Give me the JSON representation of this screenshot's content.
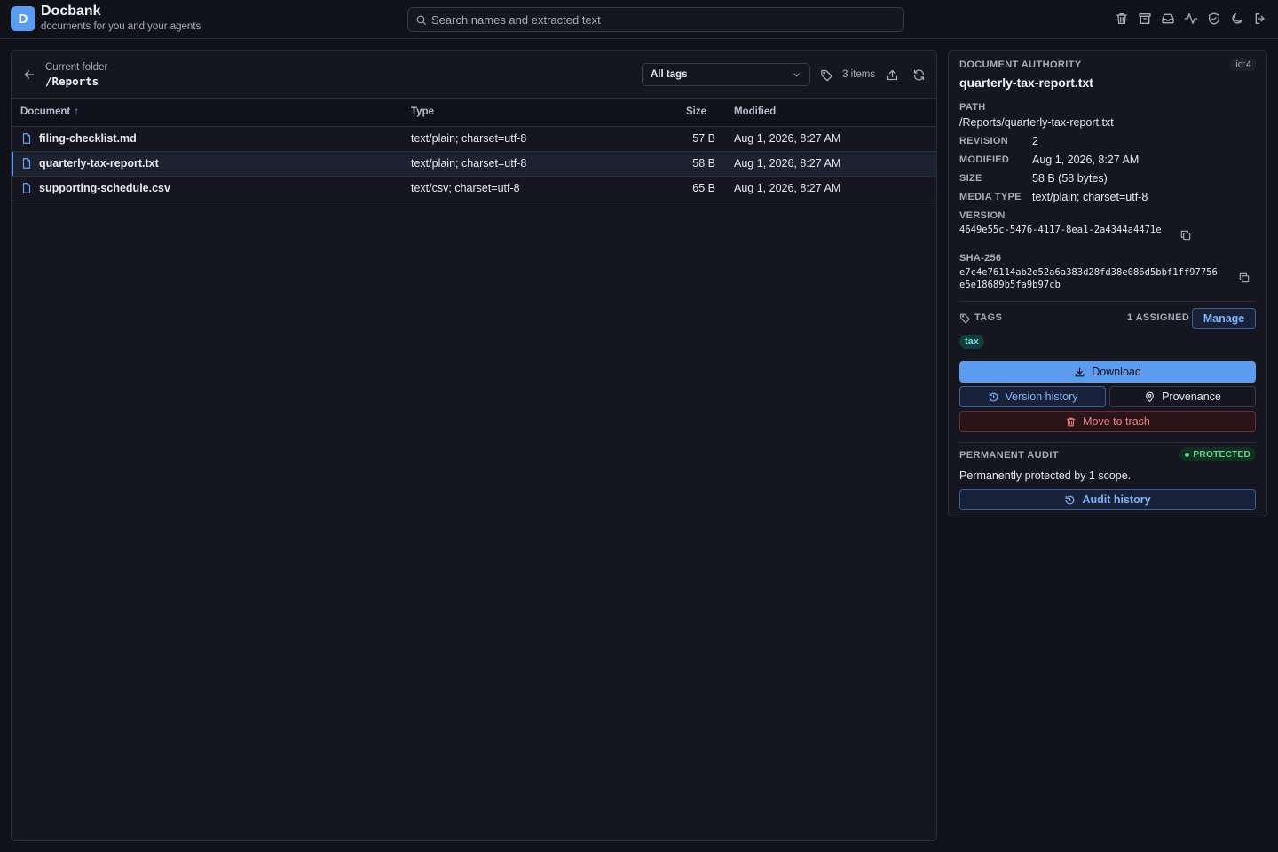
{
  "app": {
    "logo_letter": "D",
    "title": "Docbank",
    "subtitle": "documents for you and your agents"
  },
  "search": {
    "placeholder": "Search names and extracted text"
  },
  "top_icons": [
    "trash-icon",
    "archive-icon",
    "inbox-icon",
    "activity-icon",
    "shield-icon",
    "moon-icon",
    "logout-icon"
  ],
  "folder": {
    "label": "Current folder",
    "path": "/Reports",
    "tag_filter": "All tags",
    "items_count": "3 items"
  },
  "table": {
    "headers": {
      "document": "Document",
      "sort_arrow": "↑",
      "type": "Type",
      "size": "Size",
      "modified": "Modified"
    },
    "rows": [
      {
        "name": "filing-checklist.md",
        "type": "text/plain; charset=utf-8",
        "size": "57 B",
        "modified": "Aug 1, 2026, 8:27 AM"
      },
      {
        "name": "quarterly-tax-report.txt",
        "type": "text/plain; charset=utf-8",
        "size": "58 B",
        "modified": "Aug 1, 2026, 8:27 AM"
      },
      {
        "name": "supporting-schedule.csv",
        "type": "text/csv; charset=utf-8",
        "size": "65 B",
        "modified": "Aug 1, 2026, 8:27 AM"
      }
    ]
  },
  "detail": {
    "section_label": "DOCUMENT AUTHORITY",
    "id": "id:4",
    "name": "quarterly-tax-report.txt",
    "path_label": "PATH",
    "path": "/Reports/quarterly-tax-report.txt",
    "revision_label": "REVISION",
    "revision": "2",
    "modified_label": "MODIFIED",
    "modified": "Aug 1, 2026, 8:27 AM",
    "size_label": "SIZE",
    "size": "58 B (58 bytes)",
    "media_type_label": "MEDIA TYPE",
    "media_type": "text/plain; charset=utf-8",
    "version_label": "VERSION",
    "version": "4649e55c-5476-4117-8ea1-2a4344a4471e",
    "sha_label": "SHA-256",
    "sha_line1": "e7c4e76114ab2e52a6a383d28fd38e086d5bbf1ff97756",
    "sha_line2": "e5e18689b5fa9b97cb",
    "tags_label": "TAGS",
    "tags_assigned": "1 ASSIGNED",
    "manage_label": "Manage",
    "tags": [
      "tax"
    ],
    "download_label": "Download",
    "version_history_label": "Version history",
    "provenance_label": "Provenance",
    "trash_label": "Move to trash",
    "audit_label": "PERMANENT AUDIT",
    "protected_label": "PROTECTED",
    "protected_text": "Permanently protected by 1 scope.",
    "audit_history_label": "Audit history"
  },
  "colors": {
    "background": "#101119",
    "panel": "#15161f",
    "accent": "#5b9cf0",
    "danger": "#f07f86",
    "success": "#5fd08a",
    "tag": "#6be0d6"
  }
}
